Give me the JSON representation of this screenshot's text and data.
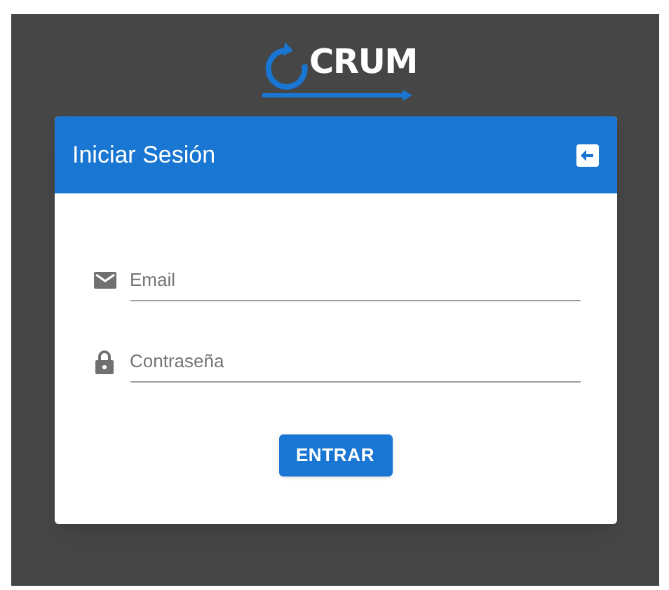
{
  "logo": {
    "text": "CRUM"
  },
  "card": {
    "title": "Iniciar Sesión"
  },
  "fields": [
    {
      "kind": "email",
      "placeholder": "Email"
    },
    {
      "kind": "password",
      "placeholder": "Contraseña"
    }
  ],
  "submit_button": "ENTRAR"
}
